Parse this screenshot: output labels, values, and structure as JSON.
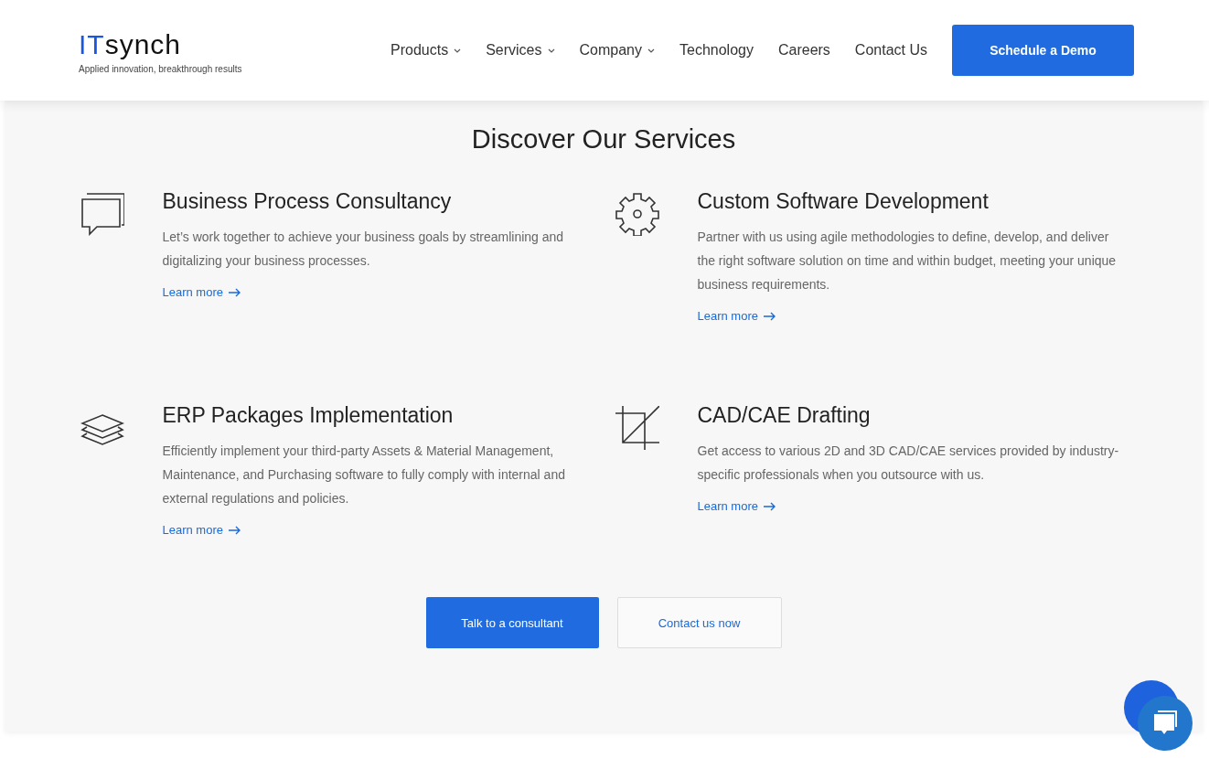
{
  "header": {
    "logo": {
      "accent": "IT",
      "rest": "synch",
      "tagline": "Applied innovation, breakthrough results"
    },
    "nav": [
      {
        "label": "Products",
        "has_menu": true
      },
      {
        "label": "Services",
        "has_menu": true
      },
      {
        "label": "Company",
        "has_menu": true
      },
      {
        "label": "Technology",
        "has_menu": false
      },
      {
        "label": "Careers",
        "has_menu": false
      },
      {
        "label": "Contact Us",
        "has_menu": false
      }
    ],
    "cta": "Schedule a Demo"
  },
  "section": {
    "title": "Discover Our Services",
    "services": [
      {
        "kind": "chat",
        "title": "Business Process Consultancy",
        "text": "Let’s work together to achieve your business goals by streamlining and digitalizing your business processes.",
        "link": "Learn more"
      },
      {
        "kind": "gear",
        "title": "Custom Software Development",
        "text": "Partner with us using agile methodologies to define, develop, and deliver the right software solution on time and within budget, meeting your unique business requirements.",
        "link": "Learn more"
      },
      {
        "kind": "layers",
        "title": "ERP Packages Implementation",
        "text": "Efficiently implement your third-party Assets & Material Management, Maintenance, and Purchasing software to fully comply with internal and external regulations and policies.",
        "link": "Learn more"
      },
      {
        "kind": "crop",
        "title": "CAD/CAE Drafting",
        "text": "Get access to various 2D and 3D CAD/CAE services provided by industry-specific professionals when you outsource with us.",
        "link": "Learn more"
      }
    ],
    "buttons": [
      {
        "kind": "primary",
        "label": "Talk to a consultant"
      },
      {
        "kind": "secondary",
        "label": "Contact us now"
      }
    ]
  }
}
